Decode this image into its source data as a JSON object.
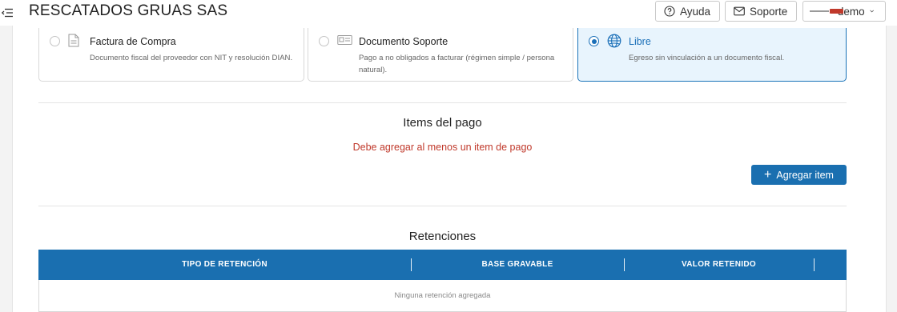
{
  "header": {
    "company": "RESCATADOS GRUAS SAS",
    "help_label": "Ayuda",
    "support_label": "Soporte",
    "user_name": "demo"
  },
  "doc_types": [
    {
      "title": "Factura de Compra",
      "description": "Documento fiscal del proveedor con NIT y resolución DIAN.",
      "selected": false,
      "icon": "document-icon"
    },
    {
      "title": "Documento Soporte",
      "description": "Pago a no obligados a facturar (régimen simple / persona natural).",
      "selected": false,
      "icon": "id-card-icon"
    },
    {
      "title": "Libre",
      "description": "Egreso sin vinculación a un documento fiscal.",
      "selected": true,
      "icon": "globe-icon"
    }
  ],
  "items": {
    "title": "Items del pago",
    "error": "Debe agregar al menos un item de pago",
    "add_label": "Agregar item"
  },
  "retenciones": {
    "title": "Retenciones",
    "columns": [
      "TIPO DE RETENCIÓN",
      "BASE GRAVABLE",
      "VALOR RETENIDO"
    ],
    "empty_message": "Ninguna retención agregada"
  },
  "colors": {
    "primary": "#1a6fb0",
    "error": "#c0392b",
    "selected_bg": "#e8f4fd"
  }
}
